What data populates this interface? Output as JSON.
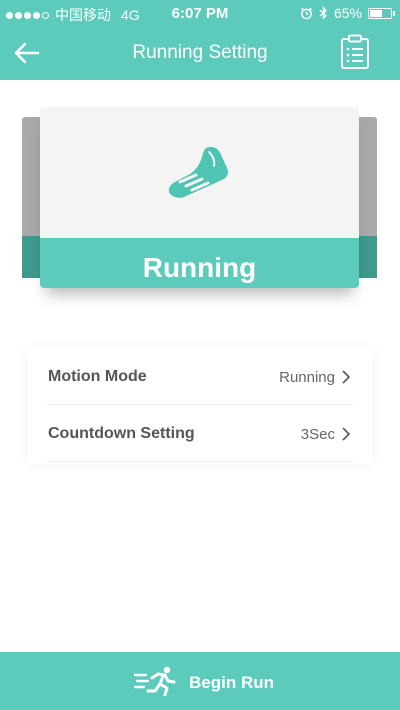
{
  "status_bar": {
    "carrier": "中国移动",
    "network": "4G",
    "time": "6:07 PM",
    "battery": "65%",
    "battery_level": 0.65,
    "signal_bars": 4,
    "icons": [
      "alarm-icon",
      "bluetooth-icon",
      "battery-icon"
    ]
  },
  "nav": {
    "title": "Running Setting",
    "back_icon": "back-arrow-icon",
    "action_icon": "clipboard-icon"
  },
  "mode_card": {
    "label": "Running",
    "icon": "running-shoe-icon"
  },
  "settings": [
    {
      "label": "Motion Mode",
      "value": "Running"
    },
    {
      "label": "Countdown Setting",
      "value": "3Sec"
    }
  ],
  "action": {
    "label": "Begin Run",
    "icon": "runner-icon"
  },
  "colors": {
    "accent": "#5ccbbb",
    "accent_dark": "#3e9a8c",
    "side_card": "#a9a9a9",
    "card_bg": "#f4f4f4"
  }
}
